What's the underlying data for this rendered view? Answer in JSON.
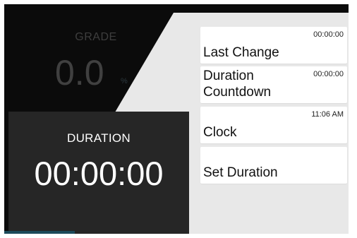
{
  "colors": {
    "panel_bg": "#e8e8e8",
    "screen_bg": "#0b0b0b",
    "duration_panel_bg": "#262626",
    "card_bg": "#ffffff",
    "accent_strip": "#1c4a5a"
  },
  "grade": {
    "label": "GRADE",
    "value": "0.0",
    "unit": "%"
  },
  "duration": {
    "label": "DURATION",
    "value": "00:00:00"
  },
  "menu": {
    "last_change": {
      "label": "Last Change",
      "time": "00:00:00"
    },
    "duration_countdown": {
      "label": "Duration Countdown",
      "time": "00:00:00"
    },
    "clock": {
      "label": "Clock",
      "time": "11:06 AM"
    },
    "set_duration": {
      "label": "Set Duration"
    }
  }
}
